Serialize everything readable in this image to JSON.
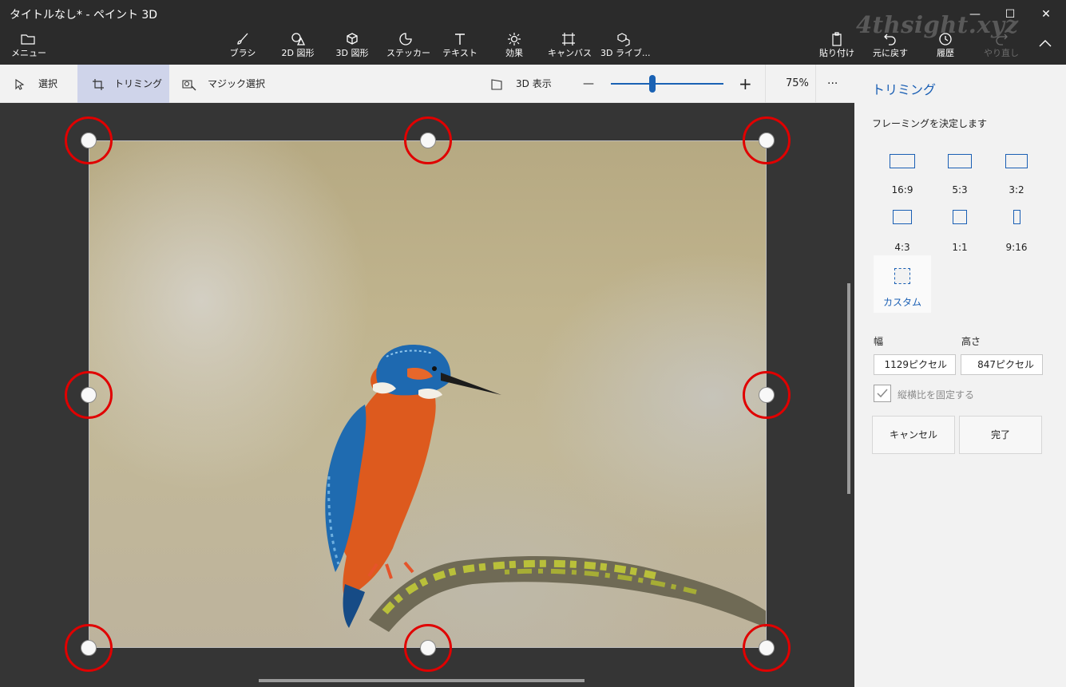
{
  "window": {
    "title": "タイトルなし* - ペイント 3D",
    "minimize_glyph": "—",
    "maximize_glyph": "☐",
    "close_glyph": "✕",
    "watermark": "4thsight.xyz"
  },
  "toolbar": {
    "menu": {
      "label": "メニュー",
      "icon": "folder-icon"
    },
    "tools": [
      {
        "label": "ブラシ",
        "icon": "brush-icon"
      },
      {
        "label": "2D 図形",
        "icon": "shapes-2d-icon"
      },
      {
        "label": "3D 図形",
        "icon": "cube-icon"
      },
      {
        "label": "ステッカー",
        "icon": "sticker-icon"
      },
      {
        "label": "テキスト",
        "icon": "text-icon"
      },
      {
        "label": "効果",
        "icon": "effects-icon"
      },
      {
        "label": "キャンバス",
        "icon": "canvas-icon"
      },
      {
        "label": "3D ライブ...",
        "icon": "library-3d-icon"
      }
    ],
    "right": [
      {
        "label": "貼り付け",
        "icon": "paste-icon"
      },
      {
        "label": "元に戻す",
        "icon": "undo-icon"
      },
      {
        "label": "履歴",
        "icon": "history-icon"
      },
      {
        "label": "やり直し",
        "icon": "redo-icon",
        "disabled": true
      }
    ],
    "collapse_glyph": "∧"
  },
  "subbar": {
    "select": "選択",
    "trim": "トリミング",
    "magic_select": "マジック選択",
    "view_3d": "3D 表示",
    "zoom_minus": "—",
    "zoom_plus": "+",
    "zoom_level": 75,
    "zoom_value": "75%",
    "more": "···"
  },
  "panel": {
    "title": "トリミング",
    "subtitle": "フレーミングを決定します",
    "ratios": [
      "16:9",
      "5:3",
      "3:2",
      "4:3",
      "1:1",
      "9:16"
    ],
    "custom": "カスタム",
    "width_label": "幅",
    "height_label": "高さ",
    "width_value": "1129ピクセル",
    "height_value": "847ピクセル",
    "lock_label": "縦横比を固定する",
    "lock_checked": true,
    "cancel": "キャンセル",
    "done": "完了"
  },
  "colors": {
    "accent": "#1a5fb4",
    "highlight_ring": "#e00000",
    "toolbar_bg": "#2b2b2b",
    "canvas_bg": "#353535",
    "panel_bg": "#f2f2f2"
  }
}
